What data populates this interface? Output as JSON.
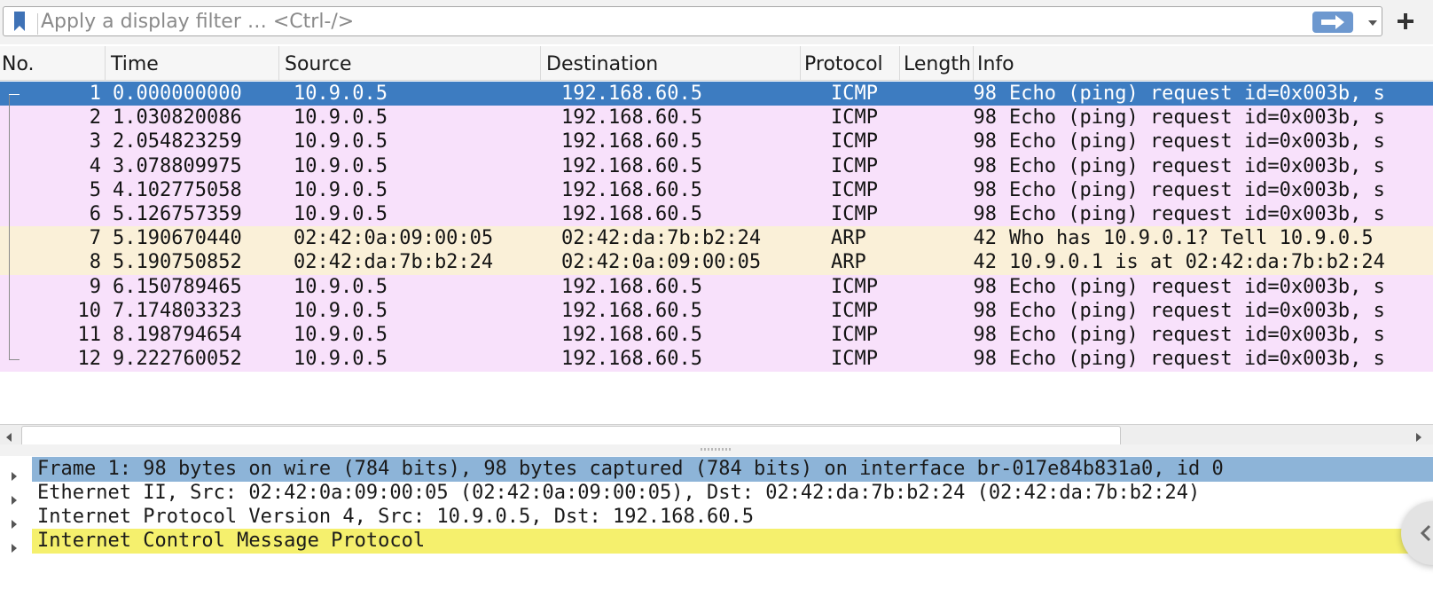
{
  "filter": {
    "placeholder": "Apply a display filter … <Ctrl-/>",
    "value": ""
  },
  "icons": {
    "bookmark": "bookmark-icon",
    "apply": "arrow-right-icon",
    "dropdown": "chevron-down-icon",
    "add": "plus-icon",
    "scroll_left": "caret-left-icon",
    "scroll_right": "caret-right-icon",
    "expander": "caret-right-icon",
    "floating": "chevron-left-icon"
  },
  "colors": {
    "icmp_row": "#f8e1fb",
    "arp_row": "#faf0d8",
    "selected_row": "#3d7cc1",
    "detail_selected": "#8db4d8",
    "detail_highlight": "#f5f06d"
  },
  "packet_list": {
    "columns": [
      "No.",
      "Time",
      "Source",
      "Destination",
      "Protocol",
      "Length",
      "Info"
    ],
    "selected_row": 1,
    "rows": [
      {
        "no": "1",
        "time": "0.000000000",
        "source": "10.9.0.5",
        "destination": "192.168.60.5",
        "protocol": "ICMP",
        "length": "98",
        "info": "Echo (ping) request  id=0x003b, s"
      },
      {
        "no": "2",
        "time": "1.030820086",
        "source": "10.9.0.5",
        "destination": "192.168.60.5",
        "protocol": "ICMP",
        "length": "98",
        "info": "Echo (ping) request  id=0x003b, s"
      },
      {
        "no": "3",
        "time": "2.054823259",
        "source": "10.9.0.5",
        "destination": "192.168.60.5",
        "protocol": "ICMP",
        "length": "98",
        "info": "Echo (ping) request  id=0x003b, s"
      },
      {
        "no": "4",
        "time": "3.078809975",
        "source": "10.9.0.5",
        "destination": "192.168.60.5",
        "protocol": "ICMP",
        "length": "98",
        "info": "Echo (ping) request  id=0x003b, s"
      },
      {
        "no": "5",
        "time": "4.102775058",
        "source": "10.9.0.5",
        "destination": "192.168.60.5",
        "protocol": "ICMP",
        "length": "98",
        "info": "Echo (ping) request  id=0x003b, s"
      },
      {
        "no": "6",
        "time": "5.126757359",
        "source": "10.9.0.5",
        "destination": "192.168.60.5",
        "protocol": "ICMP",
        "length": "98",
        "info": "Echo (ping) request  id=0x003b, s"
      },
      {
        "no": "7",
        "time": "5.190670440",
        "source": "02:42:0a:09:00:05",
        "destination": "02:42:da:7b:b2:24",
        "protocol": "ARP",
        "length": "42",
        "info": "Who has 10.9.0.1? Tell 10.9.0.5"
      },
      {
        "no": "8",
        "time": "5.190750852",
        "source": "02:42:da:7b:b2:24",
        "destination": "02:42:0a:09:00:05",
        "protocol": "ARP",
        "length": "42",
        "info": "10.9.0.1 is at 02:42:da:7b:b2:24"
      },
      {
        "no": "9",
        "time": "6.150789465",
        "source": "10.9.0.5",
        "destination": "192.168.60.5",
        "protocol": "ICMP",
        "length": "98",
        "info": "Echo (ping) request  id=0x003b, s"
      },
      {
        "no": "10",
        "time": "7.174803323",
        "source": "10.9.0.5",
        "destination": "192.168.60.5",
        "protocol": "ICMP",
        "length": "98",
        "info": "Echo (ping) request  id=0x003b, s"
      },
      {
        "no": "11",
        "time": "8.198794654",
        "source": "10.9.0.5",
        "destination": "192.168.60.5",
        "protocol": "ICMP",
        "length": "98",
        "info": "Echo (ping) request  id=0x003b, s"
      },
      {
        "no": "12",
        "time": "9.222760052",
        "source": "10.9.0.5",
        "destination": "192.168.60.5",
        "protocol": "ICMP",
        "length": "98",
        "info": "Echo (ping) request  id=0x003b, s"
      }
    ]
  },
  "details": {
    "selected_item": 0,
    "items": [
      {
        "text": "Frame 1: 98 bytes on wire (784 bits), 98 bytes captured (784 bits) on interface br-017e84b831a0, id 0"
      },
      {
        "text": "Ethernet II, Src: 02:42:0a:09:00:05 (02:42:0a:09:00:05), Dst: 02:42:da:7b:b2:24 (02:42:da:7b:b2:24)"
      },
      {
        "text": "Internet Protocol Version 4, Src: 10.9.0.5, Dst: 192.168.60.5"
      },
      {
        "text": "Internet Control Message Protocol"
      }
    ]
  }
}
